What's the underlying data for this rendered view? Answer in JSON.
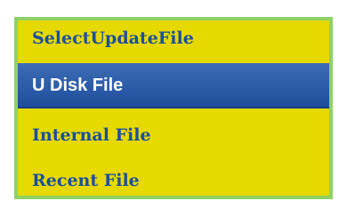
{
  "dialog": {
    "title": "SelectUpdateFile",
    "items": [
      {
        "label": "U Disk File",
        "selected": true
      },
      {
        "label": "Internal File",
        "selected": false
      },
      {
        "label": "Recent File",
        "selected": false
      }
    ]
  },
  "colors": {
    "background": "#e6d900",
    "border": "#8ed265",
    "text": "#1a4fa0",
    "selected_bg": "#2f5fab",
    "selected_text": "#ffffff"
  }
}
